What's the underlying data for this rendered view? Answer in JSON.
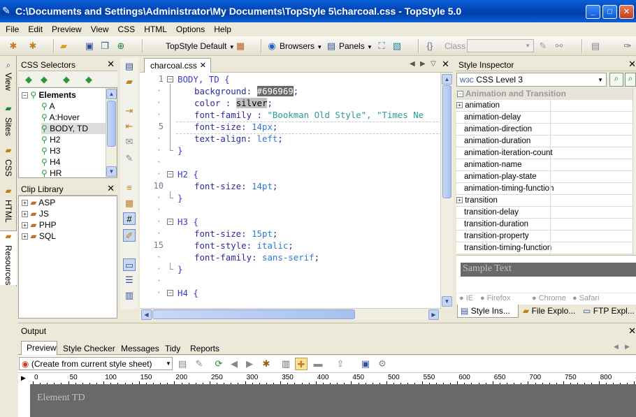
{
  "window": {
    "title": "C:\\Documents and Settings\\Administrator\\My Documents\\TopStyle 5\\charcoal.css - TopStyle 5.0",
    "controls": [
      "_",
      "□",
      "✕"
    ]
  },
  "menu": [
    "File",
    "Edit",
    "Preview",
    "View",
    "CSS",
    "HTML",
    "Options",
    "Help"
  ],
  "toolbar": {
    "style_label": "TopStyle Default",
    "browsers_label": "Browsers",
    "panels_label": "Panels",
    "class_label": "Class"
  },
  "vtabs": [
    "View",
    "Sites",
    "CSS",
    "HTML",
    "Resources"
  ],
  "css_selectors": {
    "title": "CSS Selectors",
    "root": "Elements",
    "items": [
      "A",
      "A:Hover",
      "BODY, TD",
      "H2",
      "H3",
      "H4",
      "HR"
    ],
    "selected": "BODY, TD"
  },
  "clip_library": {
    "title": "Clip Library",
    "items": [
      "ASP",
      "JS",
      "PHP",
      "SQL"
    ]
  },
  "editor": {
    "tab": "charcoal.css",
    "line_numbers": [
      "1",
      "5",
      "10",
      "15"
    ],
    "lines": [
      {
        "n": "1",
        "text": "BODY, TD {"
      },
      {
        "n": "",
        "prop": "background: ",
        "hl": "#696969",
        "rest": ";"
      },
      {
        "n": "",
        "prop": "color : ",
        "hl": "silver",
        "rest": ";"
      },
      {
        "n": "",
        "prop": "font-family : ",
        "val": "\"Bookman Old Style\", \"Times Ne"
      },
      {
        "n": "5",
        "prop": "font-size: ",
        "val": "14px",
        "rest": ";"
      },
      {
        "n": "",
        "prop": "text-align: ",
        "val": "left",
        "rest": ";"
      },
      {
        "n": "",
        "text": "}"
      },
      {
        "n": "",
        "text": ""
      },
      {
        "n": "",
        "text": "H2 {"
      },
      {
        "n": "10",
        "prop": "font-size: ",
        "val": "14pt",
        "rest": ";"
      },
      {
        "n": "",
        "text": "}"
      },
      {
        "n": "",
        "text": ""
      },
      {
        "n": "",
        "text": "H3 {"
      },
      {
        "n": "",
        "prop": "font-size: ",
        "val": "15pt",
        "rest": ";"
      },
      {
        "n": "15",
        "prop": "font-style: ",
        "val": "italic",
        "rest": ";"
      },
      {
        "n": "",
        "prop": "font-family: ",
        "val": "sans-serif",
        "rest": ";"
      },
      {
        "n": "",
        "text": "}"
      },
      {
        "n": "",
        "text": ""
      },
      {
        "n": "",
        "text": "H4 {"
      }
    ]
  },
  "inspector": {
    "title": "Style Inspector",
    "level": "CSS Level 3",
    "group": "Animation and Transition",
    "rows": [
      {
        "name": "animation",
        "expandable": true
      },
      {
        "name": "animation-delay"
      },
      {
        "name": "animation-direction"
      },
      {
        "name": "animation-duration"
      },
      {
        "name": "animation-iteration-count"
      },
      {
        "name": "animation-name"
      },
      {
        "name": "animation-play-state"
      },
      {
        "name": "animation-timing-function"
      },
      {
        "name": "transition",
        "expandable": true
      },
      {
        "name": "transition-delay"
      },
      {
        "name": "transition-duration"
      },
      {
        "name": "transition-property"
      },
      {
        "name": "transition-timing-function"
      }
    ],
    "sample": "Sample Text",
    "browsers": [
      "IE",
      "Firefox",
      "Chrome",
      "Safari"
    ],
    "bottom_tabs": [
      "Style Ins...",
      "File Explo...",
      "FTP Expl..."
    ]
  },
  "output": {
    "title": "Output",
    "tabs": [
      "Preview",
      "Style Checker",
      "Messages",
      "Tidy",
      "Reports"
    ],
    "source": "(Create from current style sheet)",
    "ruler": [
      "0",
      "50",
      "100",
      "150",
      "200",
      "250",
      "300",
      "350",
      "400",
      "450",
      "500",
      "550",
      "600",
      "650",
      "700",
      "750",
      "800",
      "850"
    ],
    "preview_text": "Element TD"
  }
}
